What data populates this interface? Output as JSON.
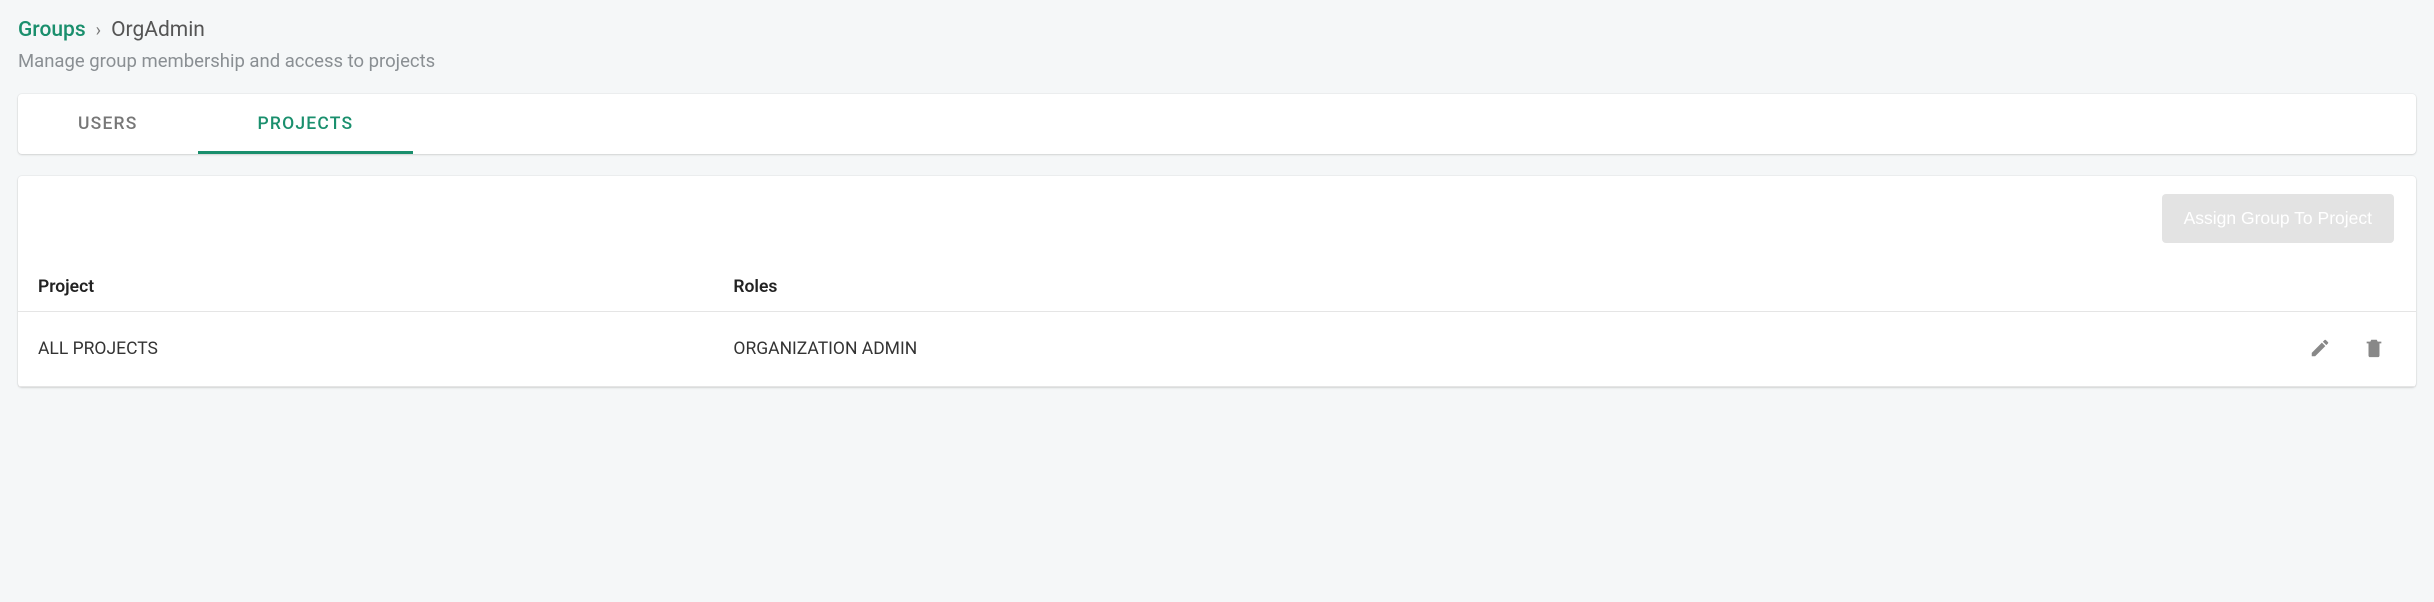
{
  "breadcrumb": {
    "root": "Groups",
    "separator": "›",
    "current": "OrgAdmin"
  },
  "subtitle": "Manage group membership and access to projects",
  "tabs": {
    "users": "USERS",
    "projects": "PROJECTS",
    "active": "projects"
  },
  "actions": {
    "assign_label": "Assign Group To Project"
  },
  "table": {
    "headers": {
      "project": "Project",
      "roles": "Roles"
    },
    "rows": [
      {
        "project": "ALL PROJECTS",
        "roles": "ORGANIZATION ADMIN"
      }
    ]
  },
  "icons": {
    "edit": "pencil-icon",
    "delete": "trash-icon"
  }
}
